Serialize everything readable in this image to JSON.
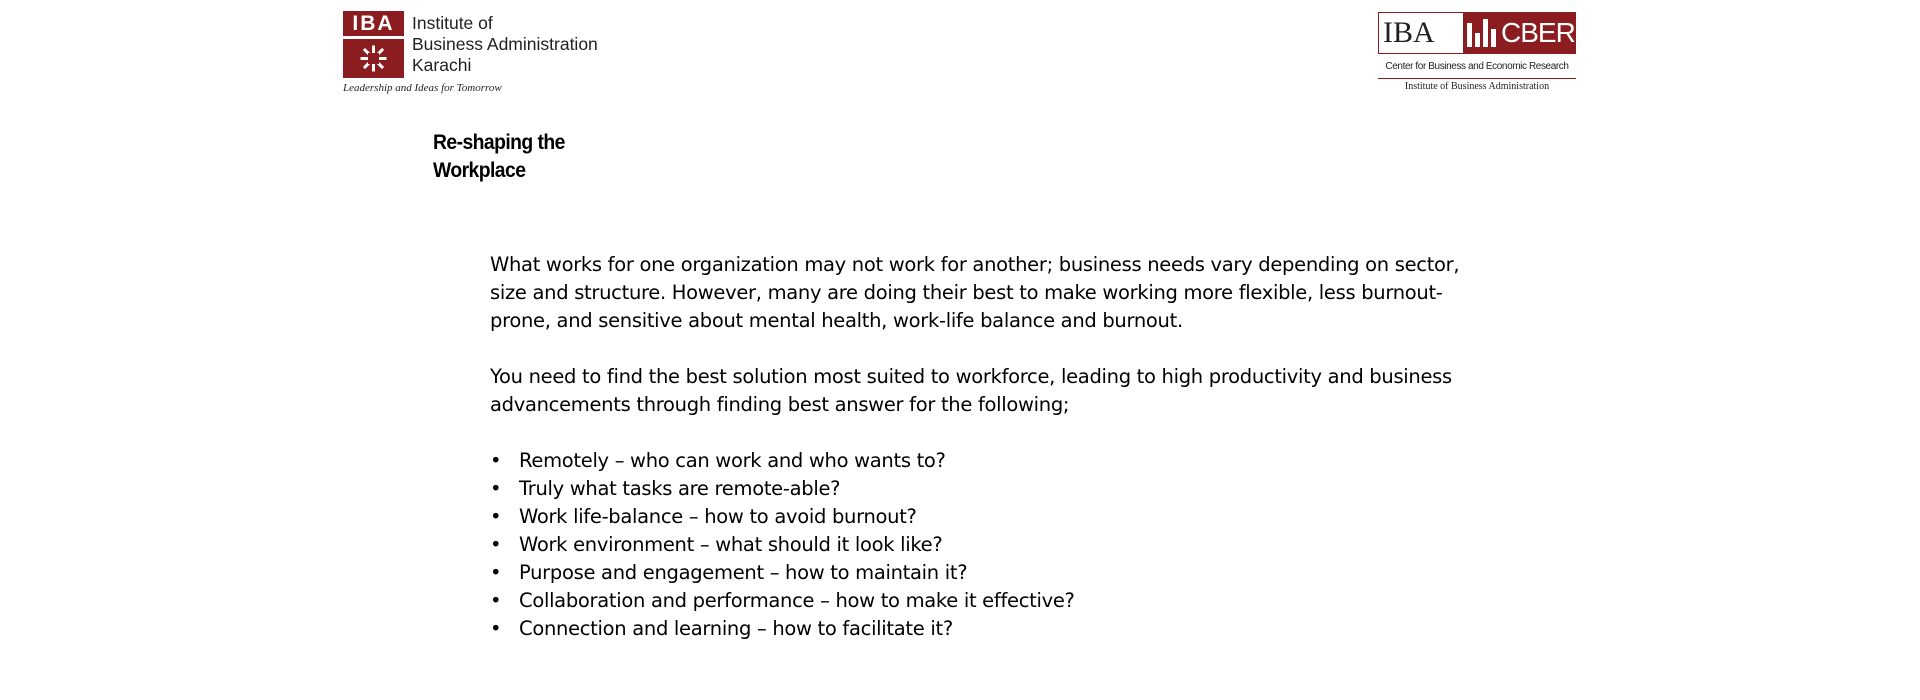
{
  "logos": {
    "iba": {
      "mark_text": "IBA",
      "name_lines": [
        "Institute of",
        "Business Administration",
        "Karachi"
      ],
      "tagline": "Leadership and Ideas for Tomorrow",
      "brand_color": "#8b1c1f"
    },
    "cber": {
      "iba_text": "IBA",
      "cber_text": "CBER",
      "subtitle": "Center for Business and Economic Research",
      "institute": "Institute of Business Administration",
      "brand_color": "#8b1c1f"
    }
  },
  "slide": {
    "title_lines": [
      "Re-shaping the",
      "Workplace"
    ],
    "paragraph1_lines": [
      "What works for one organization may not work for another; business needs vary depending on sector,",
      "size and structure. However, many are doing their best to make working more flexible, less burnout-",
      "prone, and sensitive about mental health, work-life balance and burnout."
    ],
    "paragraph2_lines": [
      "You need to find the best solution most suited to workforce, leading to high productivity and business",
      "advancements through finding best answer for the following;"
    ],
    "bullet_symbol": "•",
    "bullets": [
      "Remotely – who can work and who wants to?",
      "Truly what tasks are remote-able?",
      "Work life-balance – how to avoid burnout?",
      "Work environment – what should it look like?",
      "Purpose and engagement – how to maintain it?",
      "Collaboration and performance – how to make it effective?",
      "Connection and learning – how to facilitate it?"
    ]
  }
}
